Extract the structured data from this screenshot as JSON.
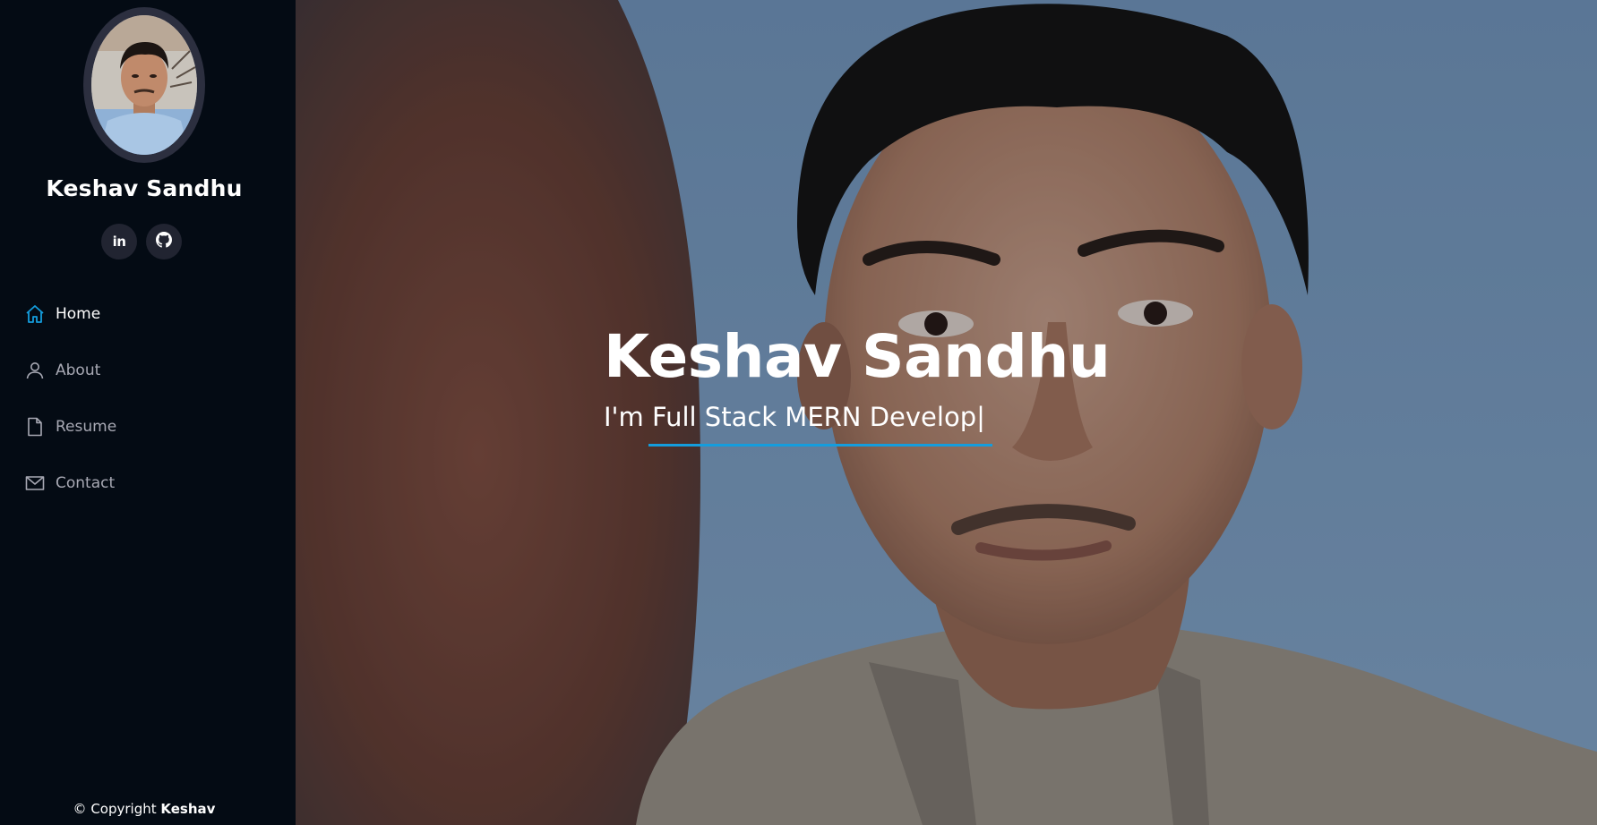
{
  "sidebar": {
    "profile_name": "Keshav Sandhu",
    "social": [
      {
        "name": "linkedin",
        "icon": "linkedin-icon"
      },
      {
        "name": "github",
        "icon": "github-icon"
      }
    ],
    "nav": [
      {
        "label": "Home",
        "icon": "home-icon",
        "active": true
      },
      {
        "label": "About",
        "icon": "person-icon",
        "active": false
      },
      {
        "label": "Resume",
        "icon": "file-icon",
        "active": false
      },
      {
        "label": "Contact",
        "icon": "envelope-icon",
        "active": false
      }
    ],
    "copyright_prefix": "© Copyright",
    "copyright_name": "Keshav"
  },
  "hero": {
    "title": "Keshav Sandhu",
    "subtitle": "I'm Full Stack MERN Develop|"
  },
  "colors": {
    "sidebar_bg": "#040b14",
    "accent": "#149ddd",
    "social_bg": "#212431",
    "nav_inactive": "#a8a9b4"
  }
}
